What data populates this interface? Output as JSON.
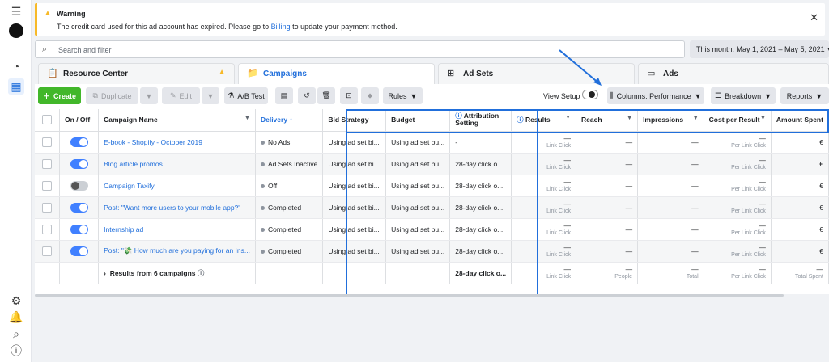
{
  "leftnav": {
    "icons": [
      "menu-icon",
      "account-avatar",
      "dashboard-icon",
      "campaigns-grid-icon",
      "settings-icon",
      "notifications-icon",
      "search-icon",
      "help-icon"
    ]
  },
  "warning": {
    "title": "Warning",
    "message_before": "The credit card used for this ad account has expired. Please go to ",
    "link": "Billing",
    "message_after": " to update your payment method."
  },
  "search": {
    "placeholder": "Search and filter"
  },
  "daterange": "This month: May 1, 2021 – May 5, 2021",
  "tabs": [
    {
      "label": "Resource Center"
    },
    {
      "label": "Campaigns"
    },
    {
      "label": "Ad Sets"
    },
    {
      "label": "Ads"
    }
  ],
  "toolbar": {
    "create": "Create",
    "duplicate": "Duplicate",
    "edit": "Edit",
    "abtest": "A/B Test",
    "rules": "Rules",
    "view_setup": "View Setup",
    "columns": "Columns: Performance",
    "breakdown": "Breakdown",
    "reports": "Reports"
  },
  "columns": [
    "On / Off",
    "Campaign Name",
    "Delivery ↑",
    "Bid Strategy",
    "Budget",
    "Attribution Setting",
    "Results",
    "Reach",
    "Impressions",
    "Cost per Result",
    "Amount Spent"
  ],
  "rows": [
    {
      "on": true,
      "name": "E-book - Shopify - October 2019",
      "delivery": "No Ads",
      "bid": "Using ad set bi...",
      "budget": "Using ad set bu...",
      "attr": "-",
      "results": "—",
      "results_sub": "Link Click",
      "reach": "—",
      "impr": "—",
      "cpr": "—",
      "cpr_sub": "Per Link Click",
      "spent": "€"
    },
    {
      "on": true,
      "name": "Blog article promos",
      "delivery": "Ad Sets Inactive",
      "bid": "Using ad set bi...",
      "budget": "Using ad set bu...",
      "attr": "28-day click o...",
      "results": "—",
      "results_sub": "Link Click",
      "reach": "—",
      "impr": "—",
      "cpr": "—",
      "cpr_sub": "Per Link Click",
      "spent": "€"
    },
    {
      "on": false,
      "name": "Campaign Taxify",
      "delivery": "Off",
      "bid": "Using ad set bi...",
      "budget": "Using ad set bu...",
      "attr": "28-day click o...",
      "results": "—",
      "results_sub": "Link Click",
      "reach": "—",
      "impr": "—",
      "cpr": "—",
      "cpr_sub": "Per Link Click",
      "spent": "€"
    },
    {
      "on": true,
      "name": "Post: \"Want more users to your mobile app?\"",
      "delivery": "Completed",
      "bid": "Using ad set bi...",
      "budget": "Using ad set bu...",
      "attr": "28-day click o...",
      "results": "—",
      "results_sub": "Link Click",
      "reach": "—",
      "impr": "—",
      "cpr": "—",
      "cpr_sub": "Per Link Click",
      "spent": "€"
    },
    {
      "on": true,
      "name": "Internship ad",
      "delivery": "Completed",
      "bid": "Using ad set bi...",
      "budget": "Using ad set bu...",
      "attr": "28-day click o...",
      "results": "—",
      "results_sub": "Link Click",
      "reach": "—",
      "impr": "—",
      "cpr": "—",
      "cpr_sub": "Per Link Click",
      "spent": "€"
    },
    {
      "on": true,
      "name": "Post: \"💸 How much are you paying for an Ins...",
      "delivery": "Completed",
      "bid": "Using ad set bi...",
      "budget": "Using ad set bu...",
      "attr": "28-day click o...",
      "results": "—",
      "results_sub": "Link Click",
      "reach": "—",
      "impr": "—",
      "cpr": "—",
      "cpr_sub": "Per Link Click",
      "spent": "€"
    }
  ],
  "totals": {
    "label": "Results from 6 campaigns",
    "attr": "28-day click o...",
    "results": "—",
    "results_sub": "Link Click",
    "reach": "—",
    "reach_sub": "People",
    "impr": "—",
    "impr_sub": "Total",
    "cpr": "—",
    "cpr_sub": "Per Link Click",
    "spent": "—",
    "spent_sub": "Total Spent"
  },
  "colors": {
    "accent": "#216fdb",
    "create": "#42b72a",
    "warning": "#f7b928"
  }
}
